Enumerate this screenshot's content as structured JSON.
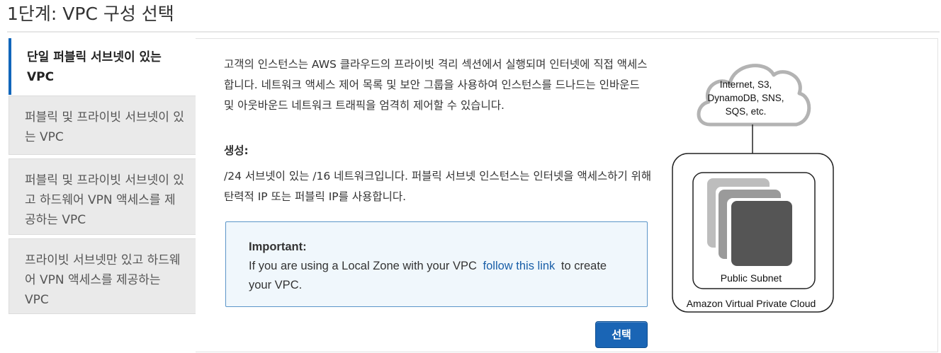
{
  "page": {
    "title": "1단계: VPC 구성 선택"
  },
  "sidebar": {
    "items": [
      {
        "label": "단일 퍼블릭 서브넷이 있는 VPC",
        "active": true
      },
      {
        "label": "퍼블릭 및 프라이빗 서브넷이 있는 VPC",
        "active": false
      },
      {
        "label": "퍼블릭 및 프라이빗 서브넷이 있고 하드웨어 VPN 액세스를 제공하는 VPC",
        "active": false
      },
      {
        "label": "프라이빗 서브넷만 있고 하드웨어 VPN 액세스를 제공하는 VPC",
        "active": false
      }
    ]
  },
  "main": {
    "description": "고객의 인스턴스는 AWS 클라우드의 프라이빗 격리 섹션에서 실행되며 인터넷에 직접 액세스합니다. 네트워크 액세스 제어 목록 및 보안 그룹을 사용하여 인스턴스를 드나드는 인바운드 및 아웃바운드 네트워크 트래픽을 엄격히 제어할 수 있습니다.",
    "created_label": "생성:",
    "created_detail": "/24 서브넷이 있는 /16 네트워크입니다. 퍼블릭 서브넷 인스턴스는 인터넷을 액세스하기 위해 탄력적 IP 또는 퍼블릭 IP를 사용합니다.",
    "important": {
      "title": "Important:",
      "text_before": "If you are using a Local Zone with your VPC",
      "link": "follow this link",
      "text_after": "to create your VPC."
    },
    "select_button": "선택"
  },
  "diagram": {
    "cloud_text": "Internet, S3, DynamoDB, SNS, SQS, etc.",
    "subnet_label": "Public Subnet",
    "vpc_label": "Amazon Virtual Private Cloud"
  },
  "colors": {
    "accent": "#1166bb",
    "button": "#1a65b5",
    "link": "#1a5fa8",
    "info_box_bg": "#f0f7fc",
    "info_box_border": "#5b95c8"
  }
}
